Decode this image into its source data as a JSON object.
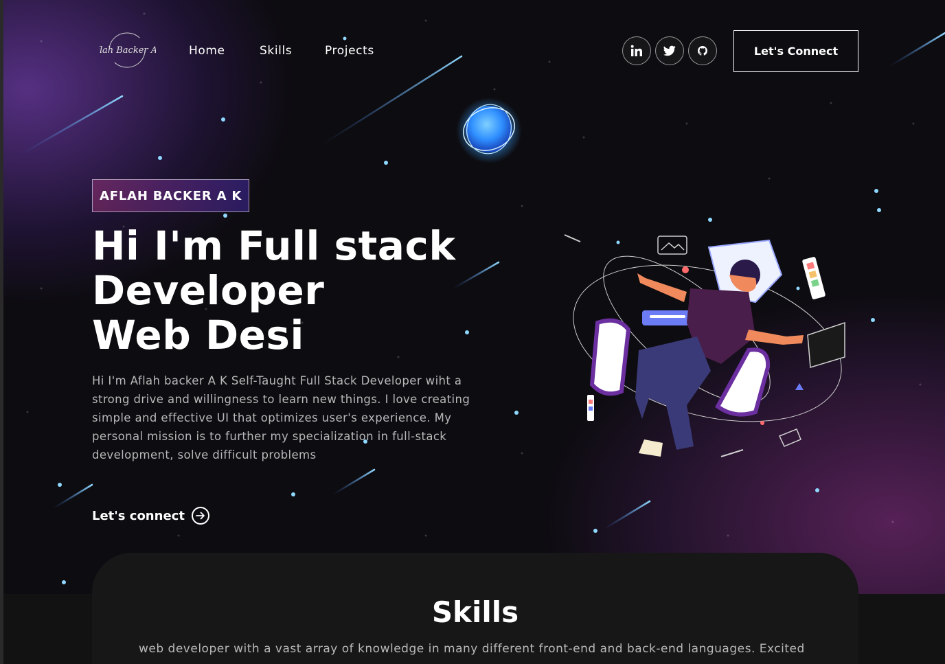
{
  "nav": {
    "logo_text": "Aflah Backer AK",
    "links": [
      "Home",
      "Skills",
      "Projects"
    ],
    "social": [
      "linkedin-icon",
      "twitter-icon",
      "github-icon"
    ],
    "connect_label": "Let's Connect"
  },
  "hero": {
    "tagline": "AFLAH BACKER A K",
    "headline_lines": [
      "Hi I'm Full stack",
      "Developer",
      "Web Desi"
    ],
    "intro": "Hi I'm Aflah backer A K Self-Taught Full Stack Developer wiht a strong drive and willingness to learn new things. I love creating simple and effective UI that optimizes user's experience. My personal mission is to further my specialization in full-stack development, solve difficult problems",
    "cta_label": "Let's connect"
  },
  "skills": {
    "title": "Skills",
    "description": "web developer with a vast array of knowledge in many different front-end and back-end languages. Excited"
  },
  "colors": {
    "background": "#121212",
    "accent_purple": "#4a2fbd",
    "accent_pink": "#aa367c",
    "text_muted": "#b8b8b8"
  }
}
